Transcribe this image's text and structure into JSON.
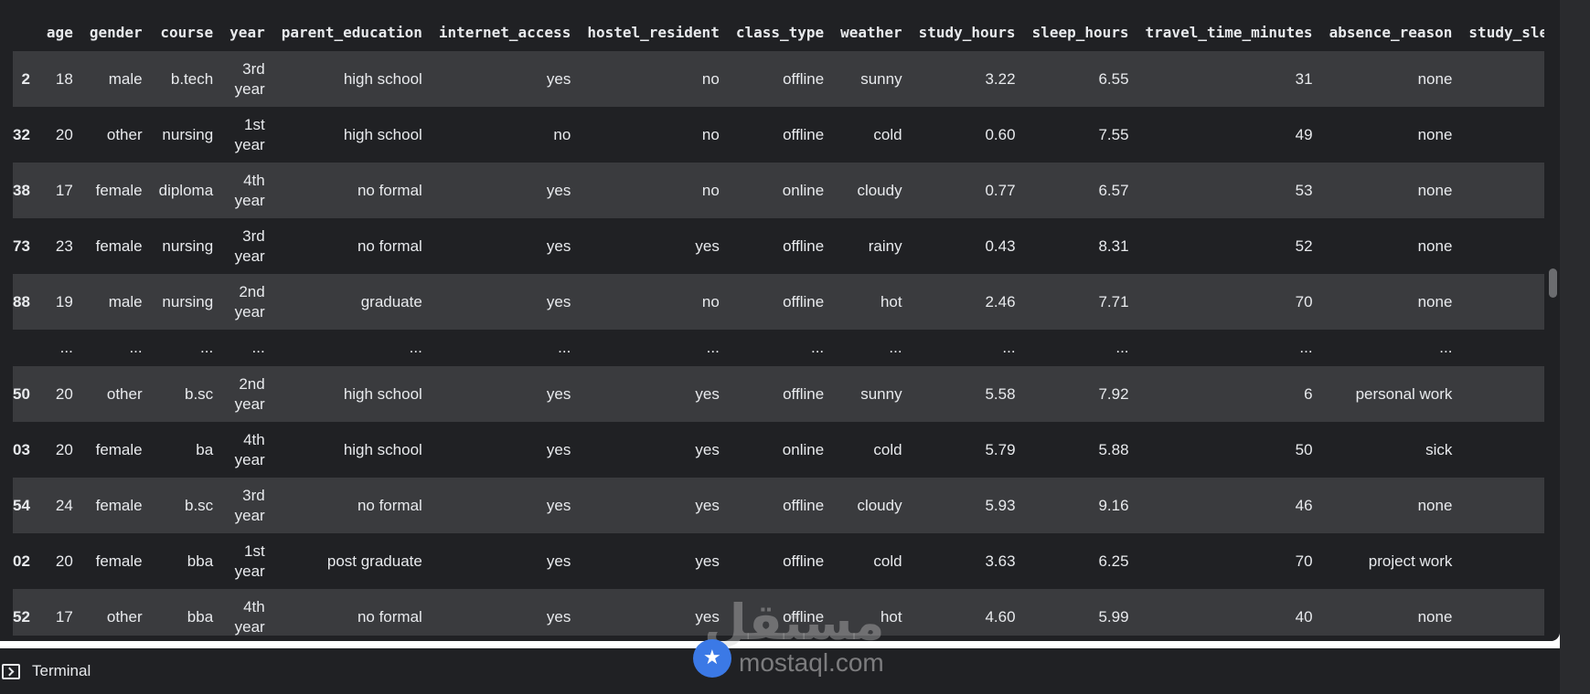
{
  "table": {
    "columns": [
      "",
      "age",
      "gender",
      "course",
      "year",
      "parent_education",
      "internet_access",
      "hostel_resident",
      "class_type",
      "weather",
      "study_hours",
      "sleep_hours",
      "travel_time_minutes",
      "absence_reason",
      "study_sle"
    ],
    "rows": [
      {
        "idx": "2",
        "age": "18",
        "gender": "male",
        "course": "b.tech",
        "year": [
          "3rd",
          "year"
        ],
        "parent_education": "high school",
        "internet_access": "yes",
        "hostel_resident": "no",
        "class_type": "offline",
        "weather": "sunny",
        "study_hours": "3.22",
        "sleep_hours": "6.55",
        "travel_time_minutes": "31",
        "absence_reason": "none"
      },
      {
        "idx": "32",
        "age": "20",
        "gender": "other",
        "course": "nursing",
        "year": [
          "1st",
          "year"
        ],
        "parent_education": "high school",
        "internet_access": "no",
        "hostel_resident": "no",
        "class_type": "offline",
        "weather": "cold",
        "study_hours": "0.60",
        "sleep_hours": "7.55",
        "travel_time_minutes": "49",
        "absence_reason": "none"
      },
      {
        "idx": "38",
        "age": "17",
        "gender": "female",
        "course": "diploma",
        "year": [
          "4th",
          "year"
        ],
        "parent_education": "no formal",
        "internet_access": "yes",
        "hostel_resident": "no",
        "class_type": "online",
        "weather": "cloudy",
        "study_hours": "0.77",
        "sleep_hours": "6.57",
        "travel_time_minutes": "53",
        "absence_reason": "none"
      },
      {
        "idx": "73",
        "age": "23",
        "gender": "female",
        "course": "nursing",
        "year": [
          "3rd",
          "year"
        ],
        "parent_education": "no formal",
        "internet_access": "yes",
        "hostel_resident": "yes",
        "class_type": "offline",
        "weather": "rainy",
        "study_hours": "0.43",
        "sleep_hours": "8.31",
        "travel_time_minutes": "52",
        "absence_reason": "none"
      },
      {
        "idx": "88",
        "age": "19",
        "gender": "male",
        "course": "nursing",
        "year": [
          "2nd",
          "year"
        ],
        "parent_education": "graduate",
        "internet_access": "yes",
        "hostel_resident": "no",
        "class_type": "offline",
        "weather": "hot",
        "study_hours": "2.46",
        "sleep_hours": "7.71",
        "travel_time_minutes": "70",
        "absence_reason": "none"
      }
    ],
    "ellipsis": "...",
    "rows_bottom": [
      {
        "idx": "50",
        "age": "20",
        "gender": "other",
        "course": "b.sc",
        "year": [
          "2nd",
          "year"
        ],
        "parent_education": "high school",
        "internet_access": "yes",
        "hostel_resident": "yes",
        "class_type": "offline",
        "weather": "sunny",
        "study_hours": "5.58",
        "sleep_hours": "7.92",
        "travel_time_minutes": "6",
        "absence_reason": "personal work"
      },
      {
        "idx": "03",
        "age": "20",
        "gender": "female",
        "course": "ba",
        "year": [
          "4th",
          "year"
        ],
        "parent_education": "high school",
        "internet_access": "yes",
        "hostel_resident": "yes",
        "class_type": "online",
        "weather": "cold",
        "study_hours": "5.79",
        "sleep_hours": "5.88",
        "travel_time_minutes": "50",
        "absence_reason": "sick"
      },
      {
        "idx": "54",
        "age": "24",
        "gender": "female",
        "course": "b.sc",
        "year": [
          "3rd",
          "year"
        ],
        "parent_education": "no formal",
        "internet_access": "yes",
        "hostel_resident": "yes",
        "class_type": "offline",
        "weather": "cloudy",
        "study_hours": "5.93",
        "sleep_hours": "9.16",
        "travel_time_minutes": "46",
        "absence_reason": "none"
      },
      {
        "idx": "02",
        "age": "20",
        "gender": "female",
        "course": "bba",
        "year": [
          "1st",
          "year"
        ],
        "parent_education": "post graduate",
        "internet_access": "yes",
        "hostel_resident": "yes",
        "class_type": "offline",
        "weather": "cold",
        "study_hours": "3.63",
        "sleep_hours": "6.25",
        "travel_time_minutes": "70",
        "absence_reason": "project work"
      },
      {
        "idx": "52",
        "age": "17",
        "gender": "other",
        "course": "bba",
        "year": [
          "4th",
          "year"
        ],
        "parent_education": "no formal",
        "internet_access": "yes",
        "hostel_resident": "yes",
        "class_type": "offline",
        "weather": "hot",
        "study_hours": "4.60",
        "sleep_hours": "5.99",
        "travel_time_minutes": "40",
        "absence_reason": "none"
      }
    ]
  },
  "terminal": {
    "label": "Terminal",
    "icon": "terminal-icon"
  },
  "watermark": {
    "arabic": "مستقل",
    "text": "mostaql.com"
  },
  "colors": {
    "background": "#202124",
    "row_alt": "#3a3b3e",
    "text": "#e8eaed"
  }
}
